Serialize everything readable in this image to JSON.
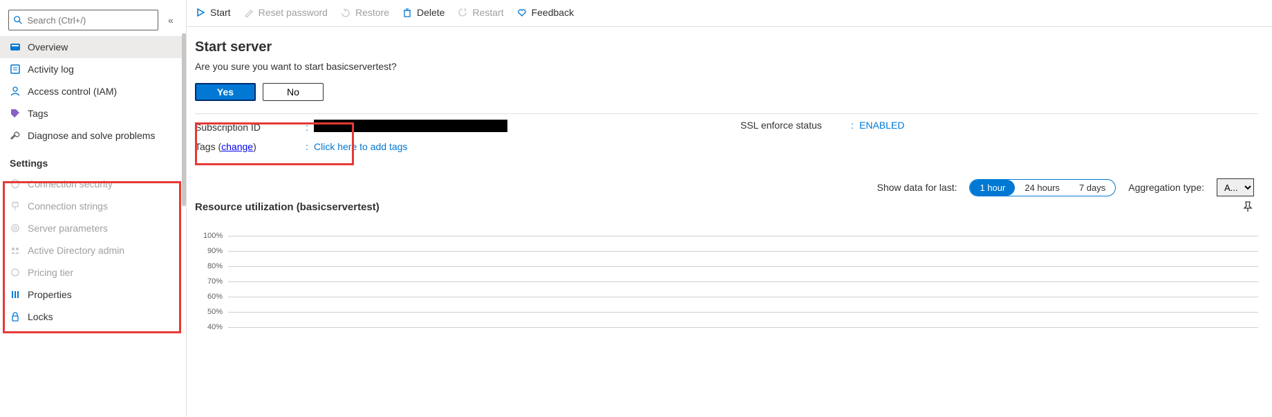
{
  "search": {
    "placeholder": "Search (Ctrl+/)"
  },
  "collapse_glyph": "«",
  "sidebar": {
    "items": [
      {
        "id": "overview",
        "label": "Overview",
        "icon": "server-icon",
        "selected": true,
        "disabled": false
      },
      {
        "id": "activitylog",
        "label": "Activity log",
        "icon": "log-icon",
        "selected": false,
        "disabled": false
      },
      {
        "id": "iam",
        "label": "Access control (IAM)",
        "icon": "user-icon",
        "selected": false,
        "disabled": false
      },
      {
        "id": "tags",
        "label": "Tags",
        "icon": "tag-icon",
        "selected": false,
        "disabled": false
      },
      {
        "id": "diagnose",
        "label": "Diagnose and solve problems",
        "icon": "wrench-icon",
        "selected": false,
        "disabled": false
      }
    ],
    "section_settings": "Settings",
    "settings_items": [
      {
        "id": "connsec",
        "label": "Connection security",
        "icon": "shield-icon",
        "disabled": true
      },
      {
        "id": "connstr",
        "label": "Connection strings",
        "icon": "plug-icon",
        "disabled": true
      },
      {
        "id": "srvparam",
        "label": "Server parameters",
        "icon": "gear-icon",
        "disabled": true
      },
      {
        "id": "adadmin",
        "label": "Active Directory admin",
        "icon": "users-icon",
        "disabled": true
      },
      {
        "id": "pricing",
        "label": "Pricing tier",
        "icon": "cog-icon",
        "disabled": true
      },
      {
        "id": "properties",
        "label": "Properties",
        "icon": "bars-icon",
        "disabled": false
      },
      {
        "id": "locks",
        "label": "Locks",
        "icon": "lock-icon",
        "disabled": false
      }
    ]
  },
  "toolbar": {
    "start": "Start",
    "reset": "Reset password",
    "restore": "Restore",
    "delete": "Delete",
    "restart": "Restart",
    "feedback": "Feedback"
  },
  "dialog": {
    "title": "Start server",
    "message": "Are you sure you want to start basicservertest?",
    "yes": "Yes",
    "no": "No"
  },
  "props": {
    "subid_key": "Subscription ID",
    "subid_val_redacted": true,
    "tags_key_prefix": "Tags (",
    "tags_change": "change",
    "tags_key_suffix": ")",
    "tags_val": "Click here to add tags",
    "ssl_key": "SSL enforce status",
    "ssl_val": "ENABLED"
  },
  "chart": {
    "show_label": "Show data for last:",
    "ranges": [
      "1 hour",
      "24 hours",
      "7 days"
    ],
    "active_range": 0,
    "agg_label": "Aggregation type:",
    "agg_value": "A...",
    "title": "Resource utilization (basicservertest)"
  },
  "chart_data": {
    "type": "line",
    "title": "Resource utilization (basicservertest)",
    "xlabel": "",
    "ylabel": "%",
    "ylim": [
      0,
      100
    ],
    "y_ticks": [
      "100%",
      "90%",
      "80%",
      "70%",
      "60%",
      "50%",
      "40%"
    ],
    "series": []
  }
}
